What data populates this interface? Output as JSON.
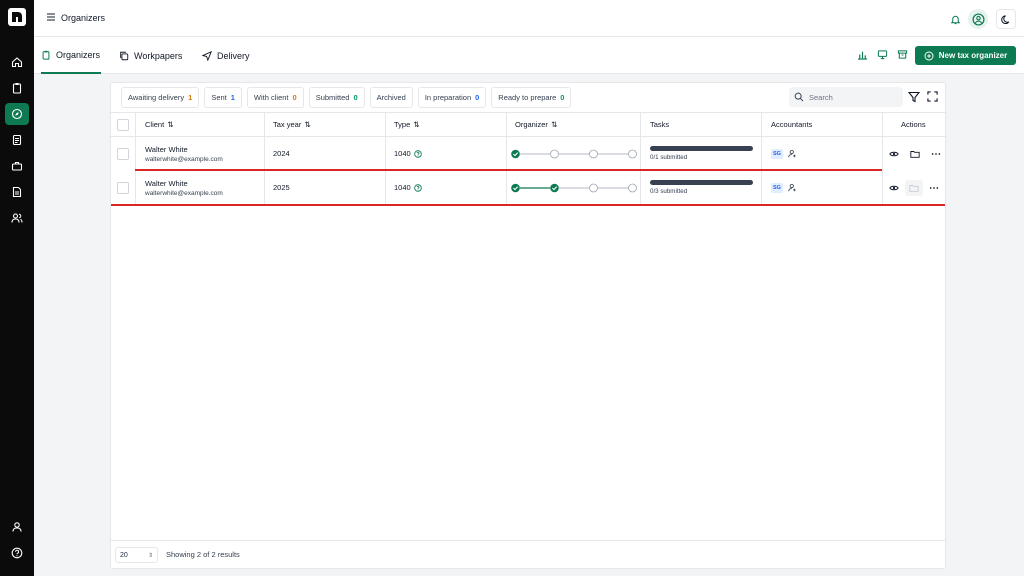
{
  "header": {
    "title": "Organizers"
  },
  "tabs": [
    {
      "label": "Organizers",
      "icon": "clipboard-icon",
      "active": true
    },
    {
      "label": "Workpapers",
      "icon": "copy-icon",
      "active": false
    },
    {
      "label": "Delivery",
      "icon": "send-icon",
      "active": false
    }
  ],
  "toolbar": {
    "new_label": "New tax organizer"
  },
  "filters": [
    {
      "label": "Awaiting delivery",
      "count": "1",
      "color": "#d97706"
    },
    {
      "label": "Sent",
      "count": "1",
      "color": "#2563eb"
    },
    {
      "label": "With client",
      "count": "0",
      "color": "#d97706"
    },
    {
      "label": "Submitted",
      "count": "0",
      "color": "#059669"
    },
    {
      "label": "Archived",
      "count": "",
      "color": "#374151"
    },
    {
      "label": "In preparation",
      "count": "0",
      "color": "#2563eb"
    },
    {
      "label": "Ready to prepare",
      "count": "0",
      "color": "#059669"
    }
  ],
  "search": {
    "placeholder": "Search"
  },
  "columns": {
    "client": "Client",
    "tax_year": "Tax year",
    "type": "Type",
    "organizer": "Organizer",
    "tasks": "Tasks",
    "accountants": "Accountants",
    "actions": "Actions"
  },
  "rows": [
    {
      "name": "Walter White",
      "email": "walterwhite@example.com",
      "tax_year": "2024",
      "type": "1040",
      "organizer_done": 1,
      "organizer_total": 4,
      "tasks": "0/1 submitted",
      "accountant": "SG"
    },
    {
      "name": "Walter White",
      "email": "walterwhite@example.com",
      "tax_year": "2025",
      "type": "1040",
      "organizer_done": 2,
      "organizer_total": 4,
      "tasks": "0/3 submitted",
      "accountant": "SG"
    }
  ],
  "footer": {
    "page_size": "20",
    "showing": "Showing 2 of 2 results"
  },
  "colors": {
    "accent": "#0d7a52",
    "highlight": "#dc2626"
  }
}
